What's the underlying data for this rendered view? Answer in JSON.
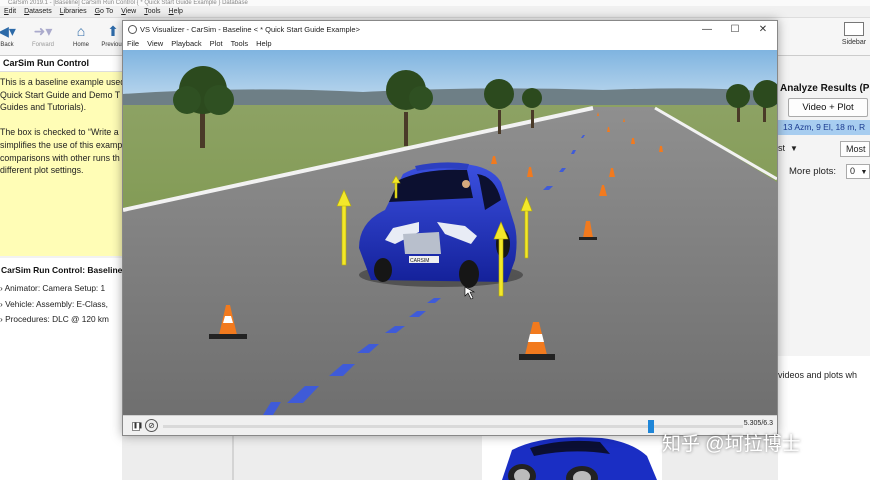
{
  "background_app": {
    "window_title": "CarSim 2019.1 - [Baseline] CarSim Run Control { * Quick Start Guide Example } Database",
    "menu": [
      "Edit",
      "Datasets",
      "Libraries",
      "Go To",
      "View",
      "Tools",
      "Help"
    ],
    "toolbar": {
      "back_label": "Back",
      "forward_label": "Forward",
      "home_label": "Home",
      "previous_label": "Previous",
      "sidebar_label": "Sidebar"
    },
    "run_control_title": "CarSim Run Control",
    "description_lines": [
      "This is a baseline example used",
      "Quick Start Guide and Demo T",
      "Guides and Tutorials).",
      "",
      "The box is checked to “Write a",
      "simplifies the use of this examp",
      "comparisons with other runs th",
      "different plot settings."
    ],
    "tree_header": "CarSim Run Control: Baseline",
    "tree_items": [
      "Animator: Camera Setup: 1",
      "Vehicle: Assembly: E-Class, ",
      "Procedures: DLC @ 120 km"
    ],
    "analyze_title": "Analyze Results (Post",
    "video_plot_button": "Video + Plot",
    "camera_selection": "13 Azm, 9 El, 18 m, R",
    "dropdown_left": "st",
    "dropdown_most": "Most",
    "more_plots_label": "More plots:",
    "more_plots_value": "0",
    "videos_text": "videos and plots wh"
  },
  "visualizer": {
    "title": "VS Visualizer - CarSim - Baseline < * Quick Start Guide Example>",
    "menu": [
      "File",
      "View",
      "Playback",
      "Plot",
      "Tools",
      "Help"
    ],
    "plate_text": "CARSIM",
    "time_readout": "5.305/6.3",
    "playback_position": 0.842
  },
  "watermark": "知乎 @坷拉博士",
  "colors": {
    "selection_blue": "#a7cdf0",
    "car_body": "#1a2ec4",
    "force_arrow": "#f3e82a",
    "cone_orange": "#f27a1e",
    "lane_marker": "#5a5ee8",
    "timeline_thumb": "#1f86d8"
  }
}
